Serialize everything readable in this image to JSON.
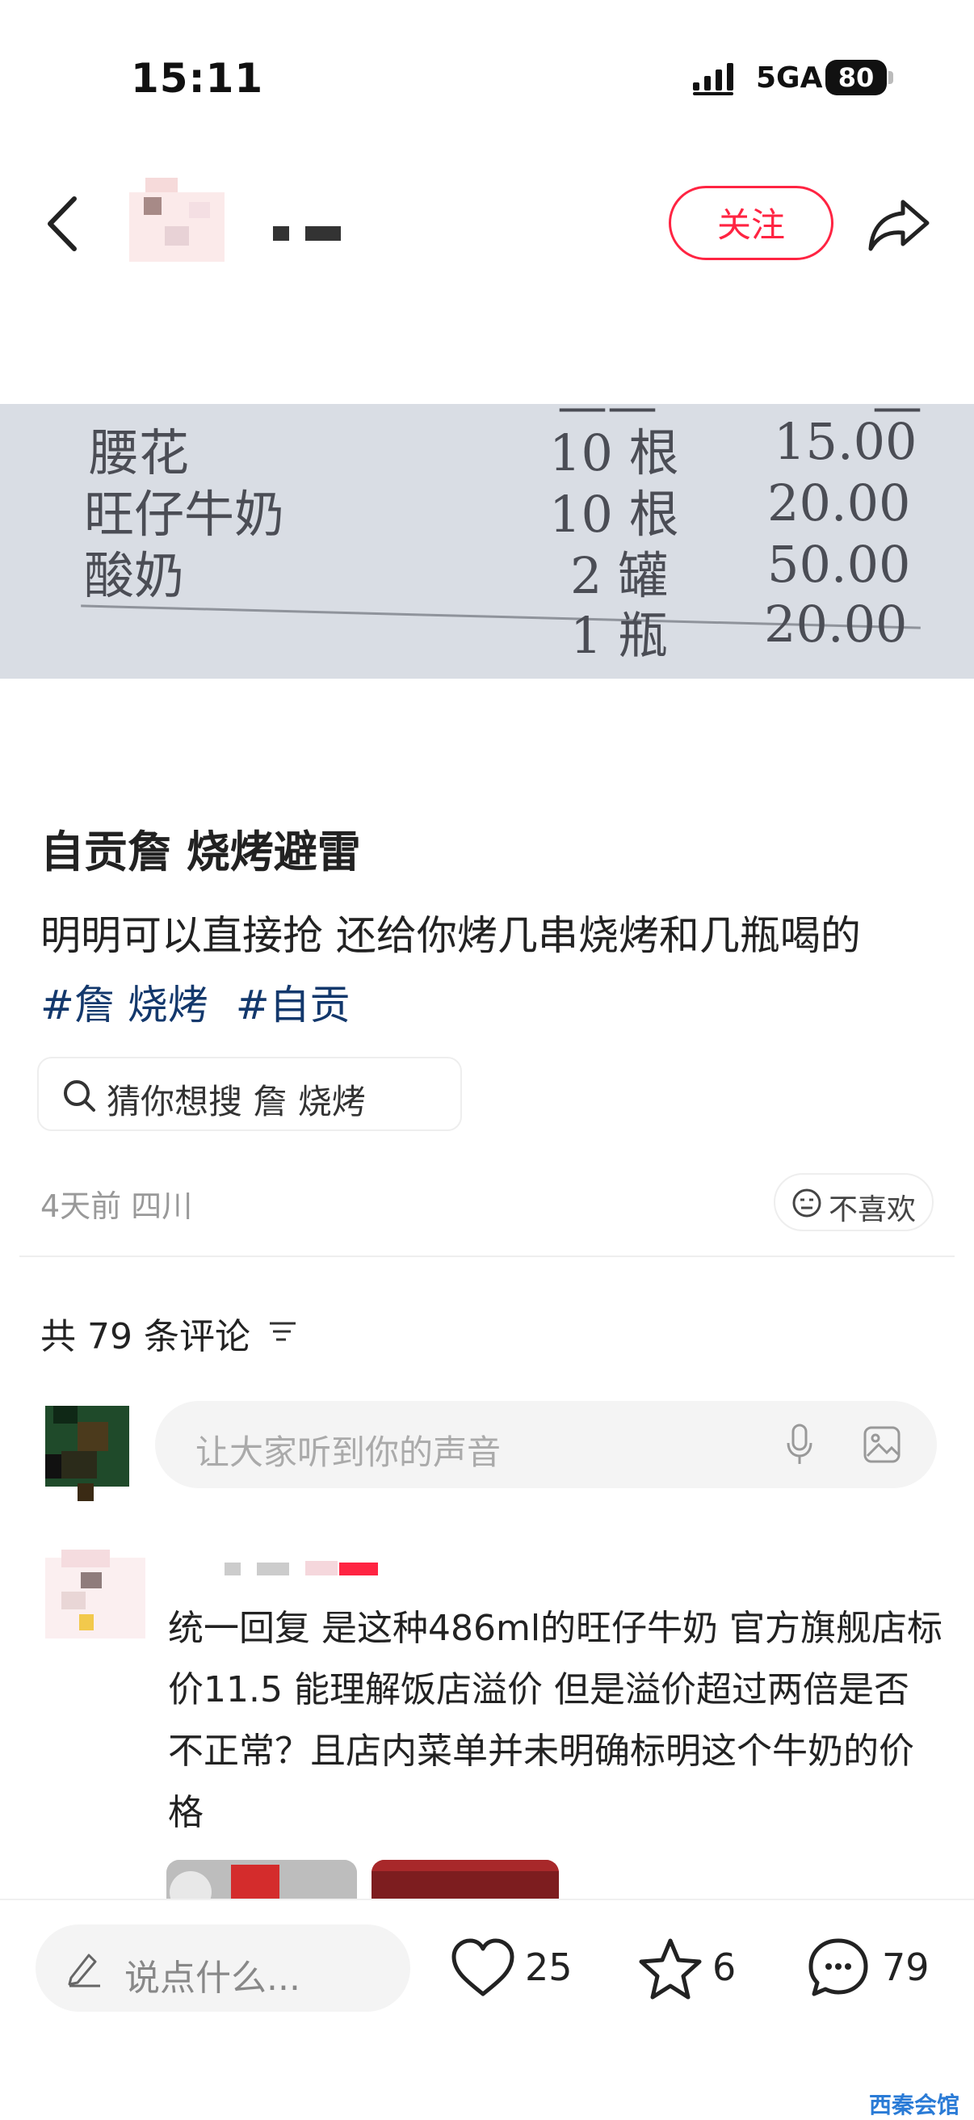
{
  "status_bar": {
    "time": "15:11",
    "network": "5GA",
    "battery": "80"
  },
  "header": {
    "follow_label": "关注"
  },
  "receipt": {
    "rows": [
      {
        "name": "腰花",
        "qty": "10 根",
        "price": "15.00"
      },
      {
        "name": "旺仔牛奶",
        "qty": "10 根",
        "price": "20.00"
      },
      {
        "name": "酸奶",
        "qty": "2 罐",
        "price": "50.00"
      },
      {
        "name": "",
        "qty": "1 瓶",
        "price": "20.00"
      }
    ]
  },
  "post": {
    "title": "自贡詹 烧烤避雷",
    "body": "明明可以直接抢 还给你烤几串烧烤和几瓶喝的",
    "tags": [
      "#詹 烧烤",
      "#自贡"
    ],
    "search_suggestion": "猜你想搜  詹 烧烤",
    "meta": "4天前 四川",
    "dislike_label": "不喜欢"
  },
  "comments": {
    "count_label": "共 79 条评论",
    "input_placeholder": "让大家听到你的声音",
    "first_comment_text": "统一回复 是这种486ml的旺仔牛奶 官方旗舰店标价11.5 能理解饭店溢价 但是溢价超过两倍是否不正常？且店内菜单并未明确标明这个牛奶的价格"
  },
  "bottom_bar": {
    "say_placeholder": "说点什么...",
    "likes": "25",
    "favorites": "6",
    "comments": "79"
  },
  "watermark": "西秦会馆",
  "colors": {
    "accent": "#ff2442",
    "tag": "#13386c"
  }
}
